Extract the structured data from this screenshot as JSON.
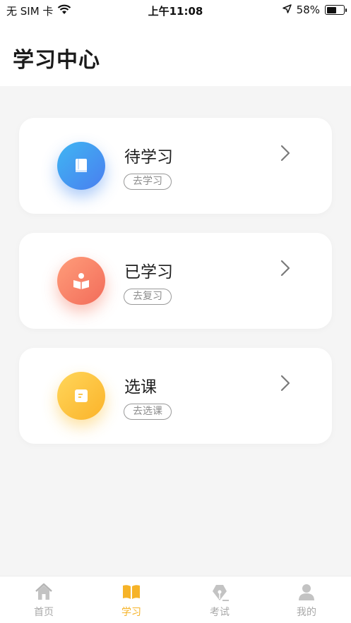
{
  "status_bar": {
    "carrier": "无 SIM 卡",
    "time": "上午11:08",
    "battery_percent": "58%",
    "battery_level": 0.58,
    "icons": [
      "wifi-icon",
      "location-arrow-icon",
      "battery-icon"
    ]
  },
  "header": {
    "title": "学习中心"
  },
  "cards": [
    {
      "title": "待学习",
      "action": "去学习",
      "icon": "book-icon",
      "accent": "#4a9bf0"
    },
    {
      "title": "已学习",
      "action": "去复习",
      "icon": "reader-icon",
      "accent": "#f47e66"
    },
    {
      "title": "选课",
      "action": "去选课",
      "icon": "note-icon",
      "accent": "#fbc13a"
    }
  ],
  "tabbar": {
    "active_color": "#f6b328",
    "inactive_color": "#a8a8a8",
    "tabs": [
      {
        "label": "首页",
        "icon": "home-icon",
        "active": false
      },
      {
        "label": "学习",
        "icon": "open-book-icon",
        "active": true
      },
      {
        "label": "考试",
        "icon": "pen-nib-icon",
        "active": false
      },
      {
        "label": "我的",
        "icon": "user-icon",
        "active": false
      }
    ]
  }
}
